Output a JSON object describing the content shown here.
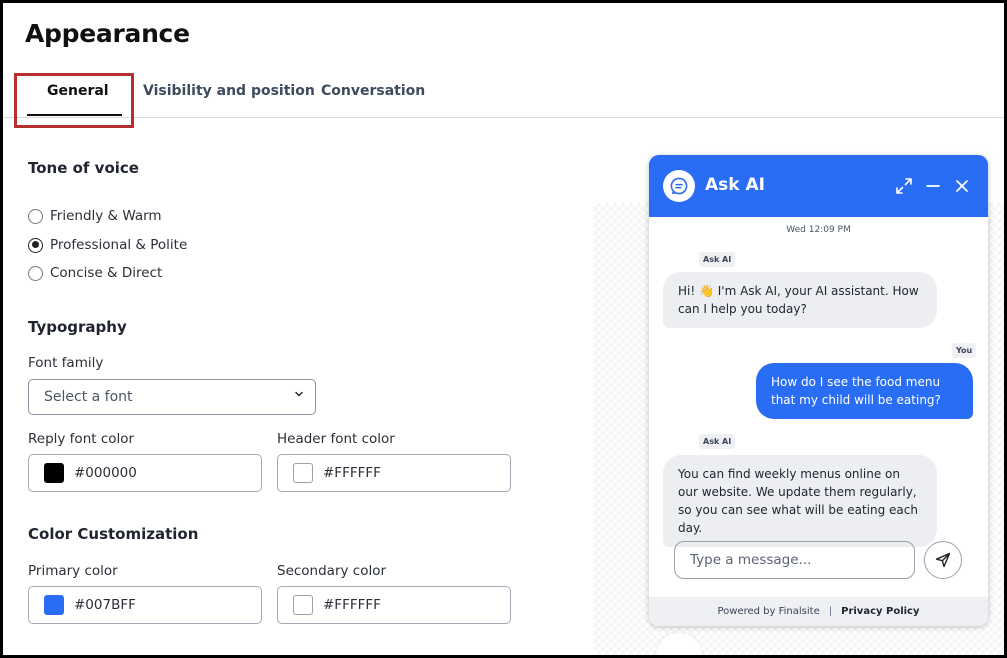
{
  "page": {
    "title": "Appearance"
  },
  "tabs": [
    {
      "label": "General",
      "active": true
    },
    {
      "label": "Visibility and position"
    },
    {
      "label": "Conversation"
    }
  ],
  "tone": {
    "title": "Tone of voice",
    "options": [
      {
        "label": "Friendly & Warm",
        "checked": false
      },
      {
        "label": "Professional & Polite",
        "checked": true
      },
      {
        "label": "Concise & Direct",
        "checked": false
      }
    ]
  },
  "typography": {
    "title": "Typography",
    "font_family_label": "Font family",
    "font_family_value": "Select a font",
    "reply_color_label": "Reply font color",
    "reply_color_value": "#000000",
    "header_color_label": "Header font color",
    "header_color_value": "#FFFFFF"
  },
  "color_customization": {
    "title": "Color Customization",
    "primary_label": "Primary color",
    "primary_value": "#007BFF",
    "secondary_label": "Secondary color",
    "secondary_value": "#FFFFFF"
  },
  "swatch_colors": {
    "reply": "#000000",
    "header": "#FFFFFF",
    "primary": "#2a6df5",
    "secondary": "#FFFFFF"
  },
  "chat": {
    "title": "Ask AI",
    "accent_color": "#2a6df5",
    "timestamp": "Wed 12:09 PM",
    "messages": [
      {
        "sender": "Ask AI",
        "role": "bot",
        "text": "Hi! 👋 I'm Ask AI, your AI assistant. How can I help you today?"
      },
      {
        "sender": "You",
        "role": "user",
        "text": "How do I see the food menu that my child will be eating?"
      },
      {
        "sender": "Ask AI",
        "role": "bot",
        "text": "You can find weekly menus online on our website. We update them regularly, so you can see what will be eating each day."
      }
    ],
    "input_placeholder": "Type a message...",
    "footer_powered": "Powered by Finalsite",
    "footer_separator": "|",
    "footer_policy": "Privacy Policy",
    "icons": [
      "chat-bubble-icon",
      "expand-icon",
      "minimize-icon",
      "close-icon",
      "send-icon"
    ]
  }
}
